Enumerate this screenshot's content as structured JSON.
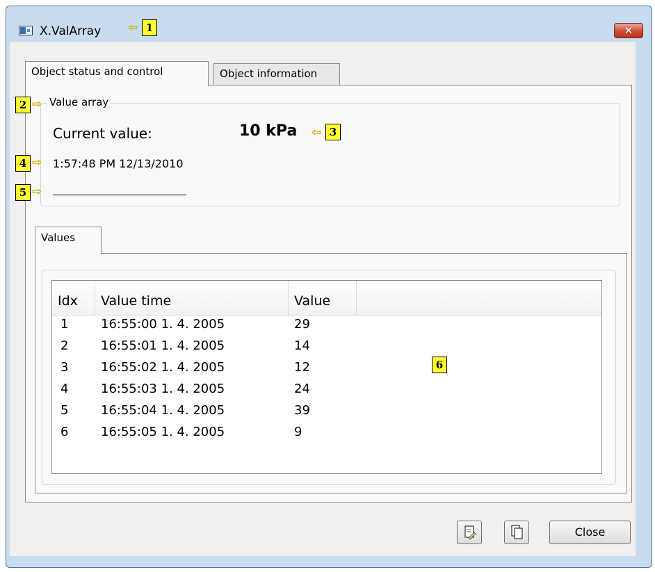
{
  "window": {
    "title": "X.ValArray",
    "close_glyph": "✕"
  },
  "tabs": [
    {
      "label": "Object status and control",
      "active": true
    },
    {
      "label": "Object information",
      "active": false
    }
  ],
  "value_array": {
    "group_title": "Value array",
    "current_value_label": "Current value:",
    "current_value": "10 kPa",
    "timestamp": "1:57:48 PM 12/13/2010"
  },
  "values_tab": {
    "label": "Values"
  },
  "table": {
    "columns": [
      "Idx",
      "Value time",
      "Value"
    ],
    "rows": [
      [
        "1",
        "16:55:00 1. 4. 2005",
        "29"
      ],
      [
        "2",
        "16:55:01 1. 4. 2005",
        "14"
      ],
      [
        "3",
        "16:55:02 1. 4. 2005",
        "12"
      ],
      [
        "4",
        "16:55:03 1. 4. 2005",
        "24"
      ],
      [
        "5",
        "16:55:04 1. 4. 2005",
        "39"
      ],
      [
        "6",
        "16:55:05 1. 4. 2005",
        "9"
      ]
    ]
  },
  "callouts": [
    "1",
    "2",
    "3",
    "4",
    "5",
    "6"
  ],
  "buttons": {
    "close_label": "Close",
    "copy_icon": "copy-icon",
    "paste_icon": "paste-icon"
  },
  "colors": {
    "callout_fill": "#ffff33",
    "window_frame": "#c9dbee",
    "close_button": "#cf4a30"
  }
}
